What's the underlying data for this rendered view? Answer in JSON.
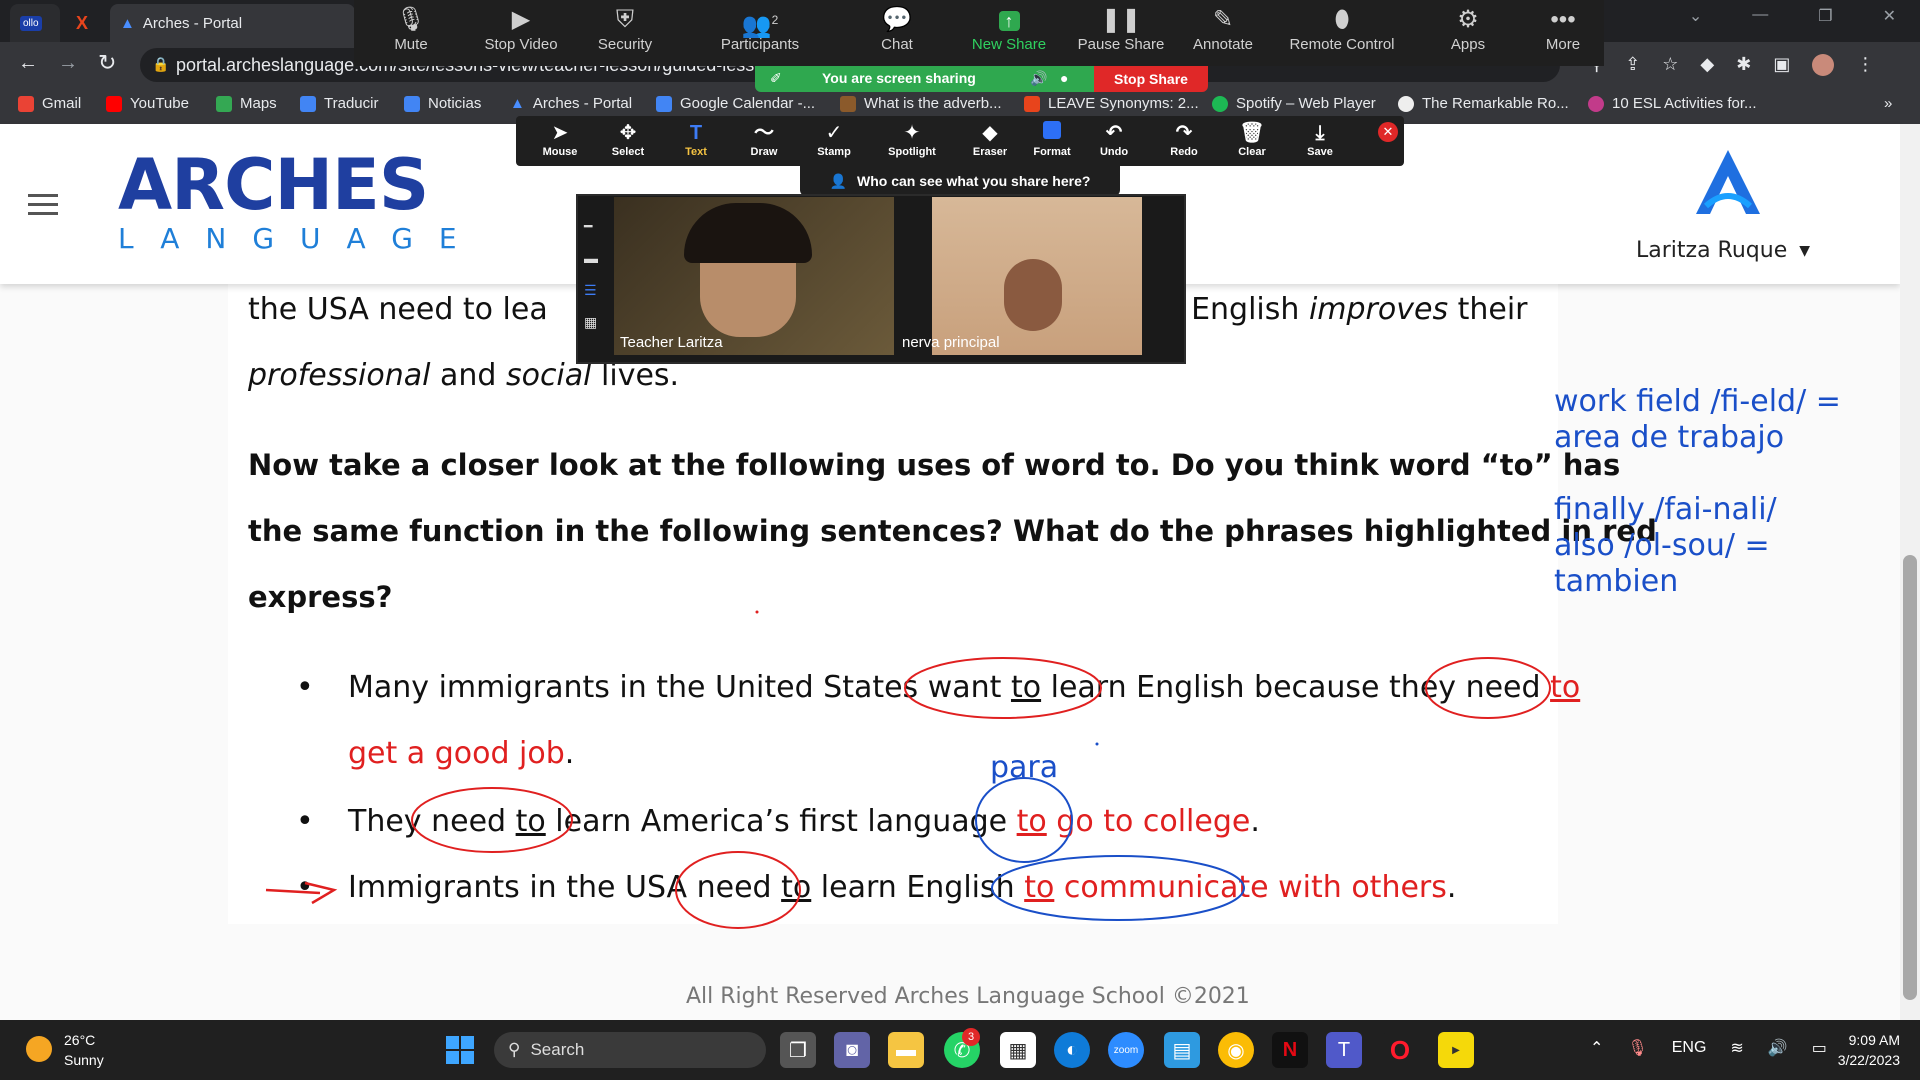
{
  "browser": {
    "tabs": [
      {
        "label": "ollo"
      },
      {
        "label": "X"
      },
      {
        "label": "Arches - Portal"
      }
    ],
    "url": "portal.archeslanguage.com/site/lessons-view/teacher-lesson/guided-lesso",
    "bookmarks": [
      "Gmail",
      "YouTube",
      "Maps",
      "Traducir",
      "Noticias",
      "Arches - Portal",
      "Google Calendar -...",
      "What is the adverb...",
      "LEAVE Synonyms: 2...",
      "Spotify – Web Player",
      "The Remarkable Ro...",
      "10 ESL Activities for..."
    ]
  },
  "zoom": {
    "toolbar": [
      {
        "label": "Mute",
        "icon": "microphone-icon"
      },
      {
        "label": "Stop Video",
        "icon": "video-camera-icon"
      },
      {
        "label": "Security",
        "icon": "shield-icon"
      },
      {
        "label": "Participants",
        "icon": "people-icon",
        "count": "2"
      },
      {
        "label": "Chat",
        "icon": "chat-bubble-icon"
      },
      {
        "label": "New Share",
        "icon": "share-arrow-icon"
      },
      {
        "label": "Pause Share",
        "icon": "pause-icon"
      },
      {
        "label": "Annotate",
        "icon": "pencil-icon"
      },
      {
        "label": "Remote Control",
        "icon": "mouse-icon"
      },
      {
        "label": "Apps",
        "icon": "apps-icon"
      },
      {
        "label": "More",
        "icon": "more-dots-icon"
      }
    ],
    "sharing_status": "You are screen sharing",
    "stop_share": "Stop Share",
    "annotate_tools": [
      "Mouse",
      "Select",
      "Text",
      "Draw",
      "Stamp",
      "Spotlight",
      "Eraser",
      "Format",
      "Undo",
      "Redo",
      "Clear",
      "Save"
    ],
    "who_can_see": "Who can see what you share here?",
    "participants": [
      {
        "name": "Teacher Laritza"
      },
      {
        "name": "nerva principal"
      }
    ]
  },
  "site": {
    "logo_top": "ARCHES",
    "logo_bottom": "LANGUAGE",
    "user_name": "Laritza Ruque",
    "footer": "All Right Reserved Arches Language School ©2021"
  },
  "lesson": {
    "line1_start": "the USA need to lea",
    "line1_end_a": ". English ",
    "line1_end_b": "improves",
    "line1_end_c": " their",
    "line2_a": "professional",
    "line2_b": " and ",
    "line2_c": "social",
    "line2_d": " lives.",
    "question_l1": "Now take a closer look at the following uses of word to. Do you think word “to” has",
    "question_l2": "the same function in the following sentences? What do the phrases highlighted in red",
    "question_l3": "express?",
    "bullets": [
      {
        "a": "Many immigrants in the United States ",
        "b": "want ",
        "c": "to",
        "d": " learn English because they ",
        "e": "need ",
        "f": "to",
        "g": "get a good job",
        "h": "."
      },
      {
        "a": "They ",
        "b": "need ",
        "c": "to",
        "d": " learn America’s first language ",
        "e": "to",
        "f": " go",
        "g": " to college",
        "h": "."
      },
      {
        "a": "Immigrants in the USA ",
        "b": "need ",
        "c": "to",
        "d": " learn English ",
        "e": "to",
        "f": " communicate",
        "g": " with others",
        "h": "."
      }
    ],
    "annotation_para": "para"
  },
  "notes": {
    "n1": "work field /fi-eld/ =",
    "n2": "area de trabajo",
    "n3": "finally /fai-nali/",
    "n4": "also /ol-sou/ =",
    "n5": "tambien"
  },
  "taskbar": {
    "weather_temp": "26°C",
    "weather_desc": "Sunny",
    "search": "Search",
    "lang": "ENG",
    "time": "9:09 AM",
    "date": "3/22/2023",
    "whatsapp_badge": "3"
  },
  "colors": {
    "brand_blue": "#1f4fbf",
    "annotation_red": "#e02020",
    "annotation_blue": "#1a4fc8",
    "zoom_green": "#2fa84f",
    "stop_red": "#e02828"
  }
}
